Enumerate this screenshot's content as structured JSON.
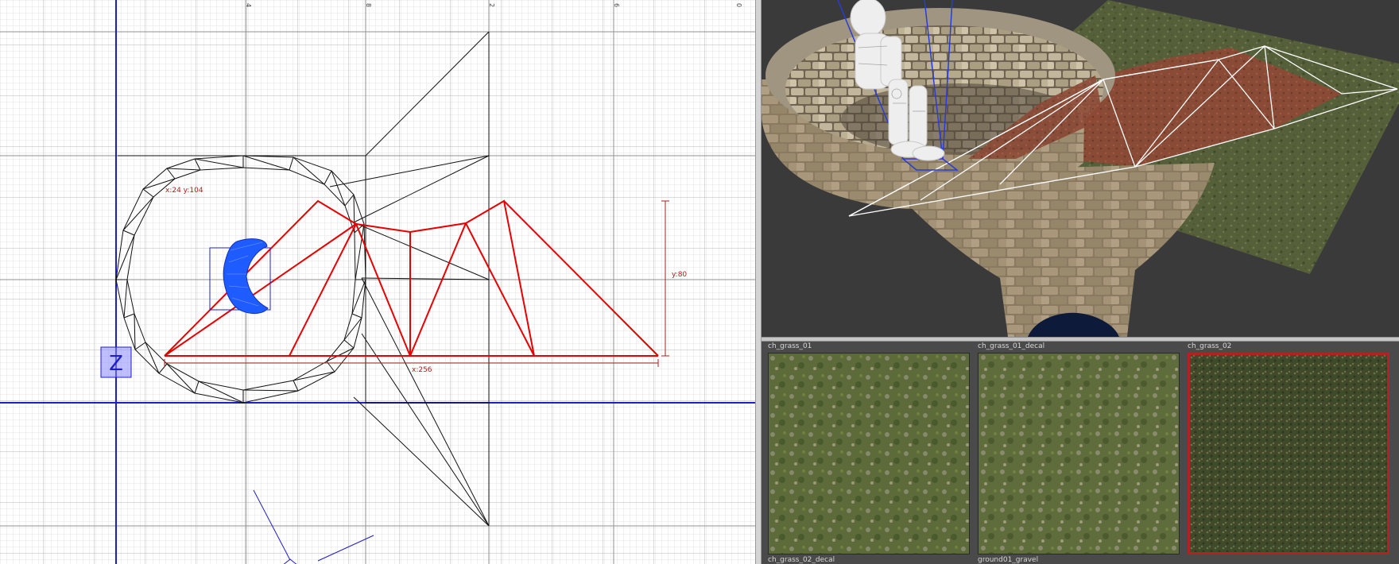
{
  "ortho_view": {
    "ruler_ticks": [
      "4",
      "8",
      "2",
      "6",
      "0"
    ],
    "cursor_readout": "x:24 y:104",
    "dim_y_label": "y:80",
    "dim_x_label": "x:256",
    "axis_letter": "Z"
  },
  "texture_browser": {
    "tiles": [
      {
        "label": "ch_grass_01",
        "selected": false
      },
      {
        "label": "ch_grass_01_decal",
        "selected": false
      },
      {
        "label": "ch_grass_02",
        "selected": true
      }
    ],
    "bottom_labels": [
      "ch_grass_02_decal",
      "ground01_gravel"
    ]
  },
  "colors": {
    "grid_line": "#e2e2e2",
    "grid_major": "#b4b4b4",
    "axis_blue": "#1f1fc8",
    "selection_red": "#e60000",
    "dimension_red": "#aa2020",
    "selected_tile_border": "#b22222"
  }
}
